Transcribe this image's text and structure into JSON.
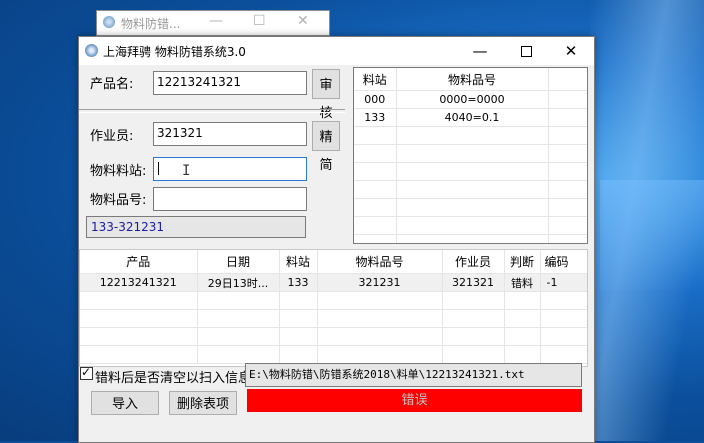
{
  "bg_window": {
    "title": "物料防错..."
  },
  "window": {
    "title": "上海拜骋 物料防错系统3.0"
  },
  "form": {
    "product_label": "产品名:",
    "product_value": "12213241321",
    "audit_button": "审核",
    "operator_label": "作业员:",
    "operator_value": "321321",
    "simplify_button": "精简",
    "station_label": "物料料站:",
    "station_value": "",
    "partno_label": "物料品号:",
    "partno_value": "",
    "status_text": "133-321231"
  },
  "right_grid": {
    "headers": [
      "料站",
      "物料品号"
    ],
    "rows": [
      [
        "000",
        "0000=0000"
      ],
      [
        "133",
        "4040=0.1"
      ]
    ]
  },
  "log_grid": {
    "headers": [
      "产品",
      "日期",
      "料站",
      "物料品号",
      "作业员",
      "判断",
      "编码"
    ],
    "rows": [
      [
        "12213241321",
        "29日13时...",
        "133",
        "321231",
        "321321",
        "错料",
        "-1"
      ]
    ]
  },
  "footer": {
    "checkbox_label": "错料后是否清空以扫入信息",
    "checkbox_checked": true,
    "file_path": "E:\\物料防错\\防错系统2018\\料单\\12213241321.txt",
    "import_button": "导入",
    "delete_button": "删除表项",
    "result_text": "错误",
    "result_color": "#ff0000"
  }
}
